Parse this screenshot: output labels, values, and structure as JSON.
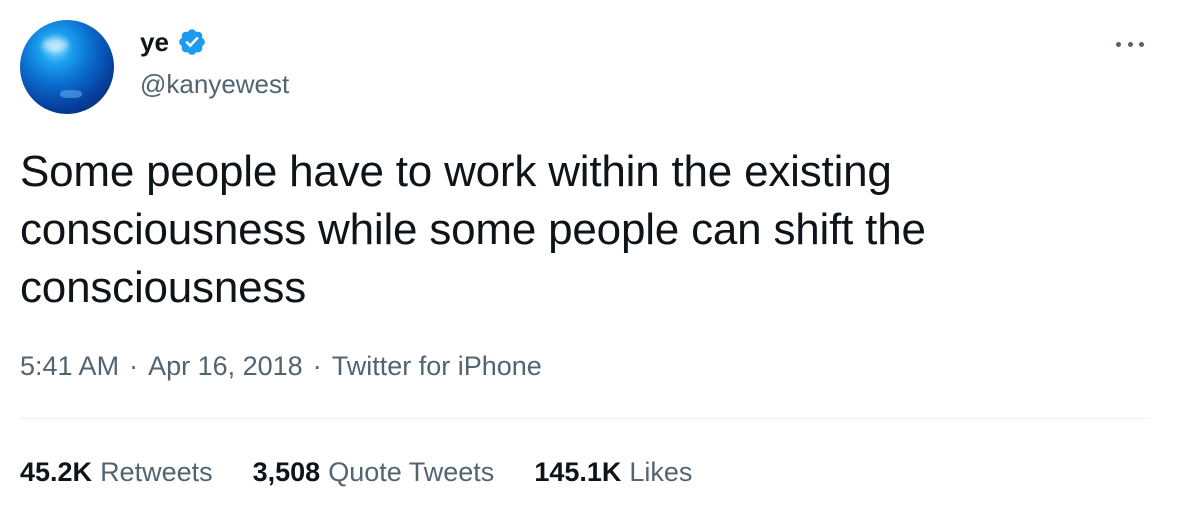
{
  "author": {
    "display_name": "ye",
    "handle": "@kanyewest",
    "verified": true
  },
  "tweet": {
    "text": "Some people have to work within the existing\nconsciousness while some people can shift the\nconsciousness"
  },
  "meta": {
    "time": "5:41 AM",
    "separator": "·",
    "date": "Apr 16, 2018",
    "source": "Twitter for iPhone"
  },
  "stats": {
    "retweets": {
      "count": "45.2K",
      "label": "Retweets"
    },
    "quote_tweets": {
      "count": "3,508",
      "label": "Quote Tweets"
    },
    "likes": {
      "count": "145.1K",
      "label": "Likes"
    }
  },
  "colors": {
    "text_primary": "#0f1419",
    "text_secondary": "#536471",
    "verified_blue": "#1d9bf0",
    "divider": "#eff3f4"
  },
  "icons": {
    "verified": "verified-badge-icon",
    "more": "more-horizontal-icon"
  }
}
